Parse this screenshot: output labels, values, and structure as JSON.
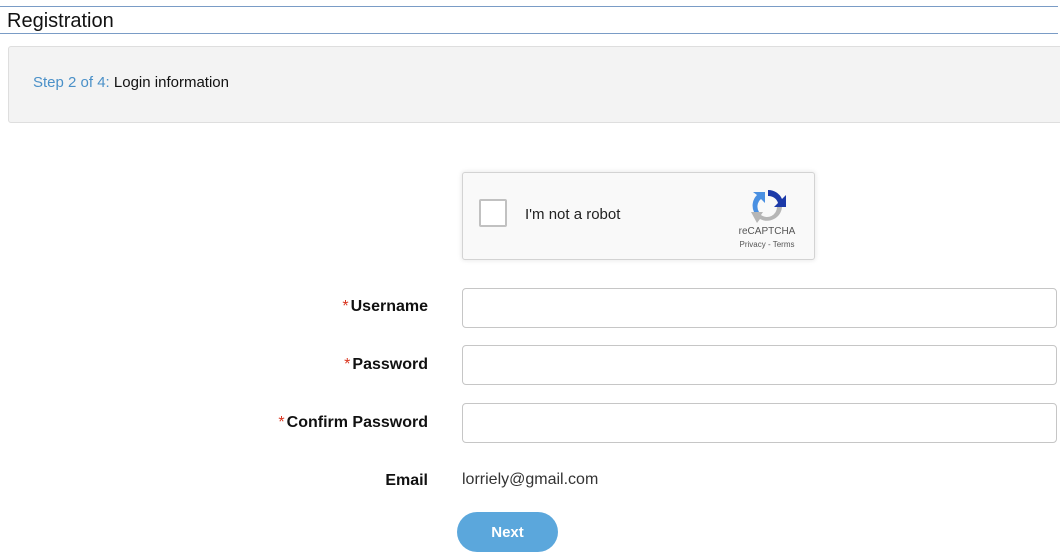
{
  "header": {
    "title": "Registration"
  },
  "step": {
    "prefix": "Step 2 of 4:",
    "label": "Login information"
  },
  "captcha": {
    "label": "I'm not a robot",
    "brand": "reCAPTCHA",
    "links": "Privacy - Terms",
    "checked": false
  },
  "form": {
    "required_marker": "*",
    "username": {
      "label": "Username",
      "value": ""
    },
    "password": {
      "label": "Password",
      "value": ""
    },
    "confirm_password": {
      "label": "Confirm Password",
      "value": ""
    },
    "email": {
      "label": "Email",
      "value": "lorriely@gmail.com"
    }
  },
  "actions": {
    "next_label": "Next"
  },
  "colors": {
    "accent": "#5ba7dc",
    "step_prefix": "#4a90c8",
    "required": "#d9341e"
  }
}
